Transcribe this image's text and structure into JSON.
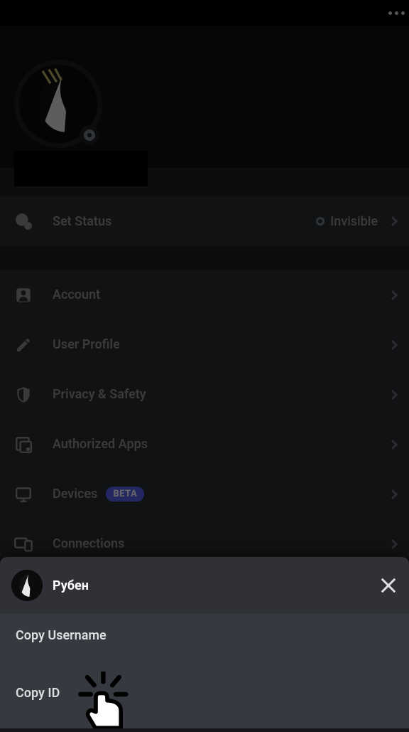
{
  "topbar": {
    "more_label": "more"
  },
  "profile": {
    "status_presence": "offline"
  },
  "status_row": {
    "label": "Set Status",
    "value": "Invisible"
  },
  "settings_items": [
    {
      "icon": "person",
      "label": "Account"
    },
    {
      "icon": "pencil",
      "label": "User Profile"
    },
    {
      "icon": "shield",
      "label": "Privacy & Safety"
    },
    {
      "icon": "apps",
      "label": "Authorized Apps"
    },
    {
      "icon": "monitor",
      "label": "Devices",
      "badge": "BETA"
    },
    {
      "icon": "devices",
      "label": "Connections"
    }
  ],
  "sheet": {
    "username": "Рубен",
    "copy_username": "Copy Username",
    "copy_id": "Copy ID"
  }
}
